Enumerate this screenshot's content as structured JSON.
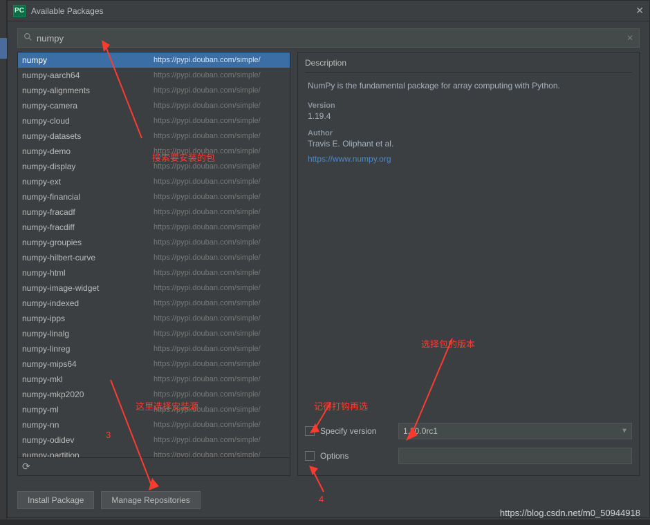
{
  "titlebar": {
    "title": "Available Packages"
  },
  "search": {
    "value": "numpy",
    "placeholder": ""
  },
  "repo_url": "https://pypi.douban.com/simple/",
  "packages": [
    {
      "name": "numpy",
      "selected": true
    },
    {
      "name": "numpy-aarch64"
    },
    {
      "name": "numpy-alignments"
    },
    {
      "name": "numpy-camera"
    },
    {
      "name": "numpy-cloud"
    },
    {
      "name": "numpy-datasets"
    },
    {
      "name": "numpy-demo"
    },
    {
      "name": "numpy-display"
    },
    {
      "name": "numpy-ext"
    },
    {
      "name": "numpy-financial"
    },
    {
      "name": "numpy-fracadf"
    },
    {
      "name": "numpy-fracdiff"
    },
    {
      "name": "numpy-groupies"
    },
    {
      "name": "numpy-hilbert-curve"
    },
    {
      "name": "numpy-html"
    },
    {
      "name": "numpy-image-widget"
    },
    {
      "name": "numpy-indexed"
    },
    {
      "name": "numpy-ipps"
    },
    {
      "name": "numpy-linalg"
    },
    {
      "name": "numpy-linreg"
    },
    {
      "name": "numpy-mips64"
    },
    {
      "name": "numpy-mkl"
    },
    {
      "name": "numpy-mkp2020"
    },
    {
      "name": "numpy-ml"
    },
    {
      "name": "numpy-nn"
    },
    {
      "name": "numpy-odidev"
    },
    {
      "name": "numpy-partition"
    }
  ],
  "description": {
    "header": "Description",
    "text": "NumPy is the fundamental package for array computing with Python.",
    "version_label": "Version",
    "version_value": "1.19.4",
    "author_label": "Author",
    "author_value": "Travis E. Oliphant et al.",
    "link": "https://www.numpy.org"
  },
  "specify": {
    "label": "Specify version",
    "value": "1.20.0rc1"
  },
  "options": {
    "label": "Options",
    "value": ""
  },
  "buttons": {
    "install": "Install Package",
    "manage": "Manage Repositories"
  },
  "annotations": {
    "search_pkg": "搜索要安装的包",
    "select_source": "这里选择安装源",
    "num3": "3",
    "select_version": "选择包的版本",
    "check_first": "记得打钩再选",
    "num4": "4"
  },
  "watermark": "https://blog.csdn.net/m0_50944918"
}
